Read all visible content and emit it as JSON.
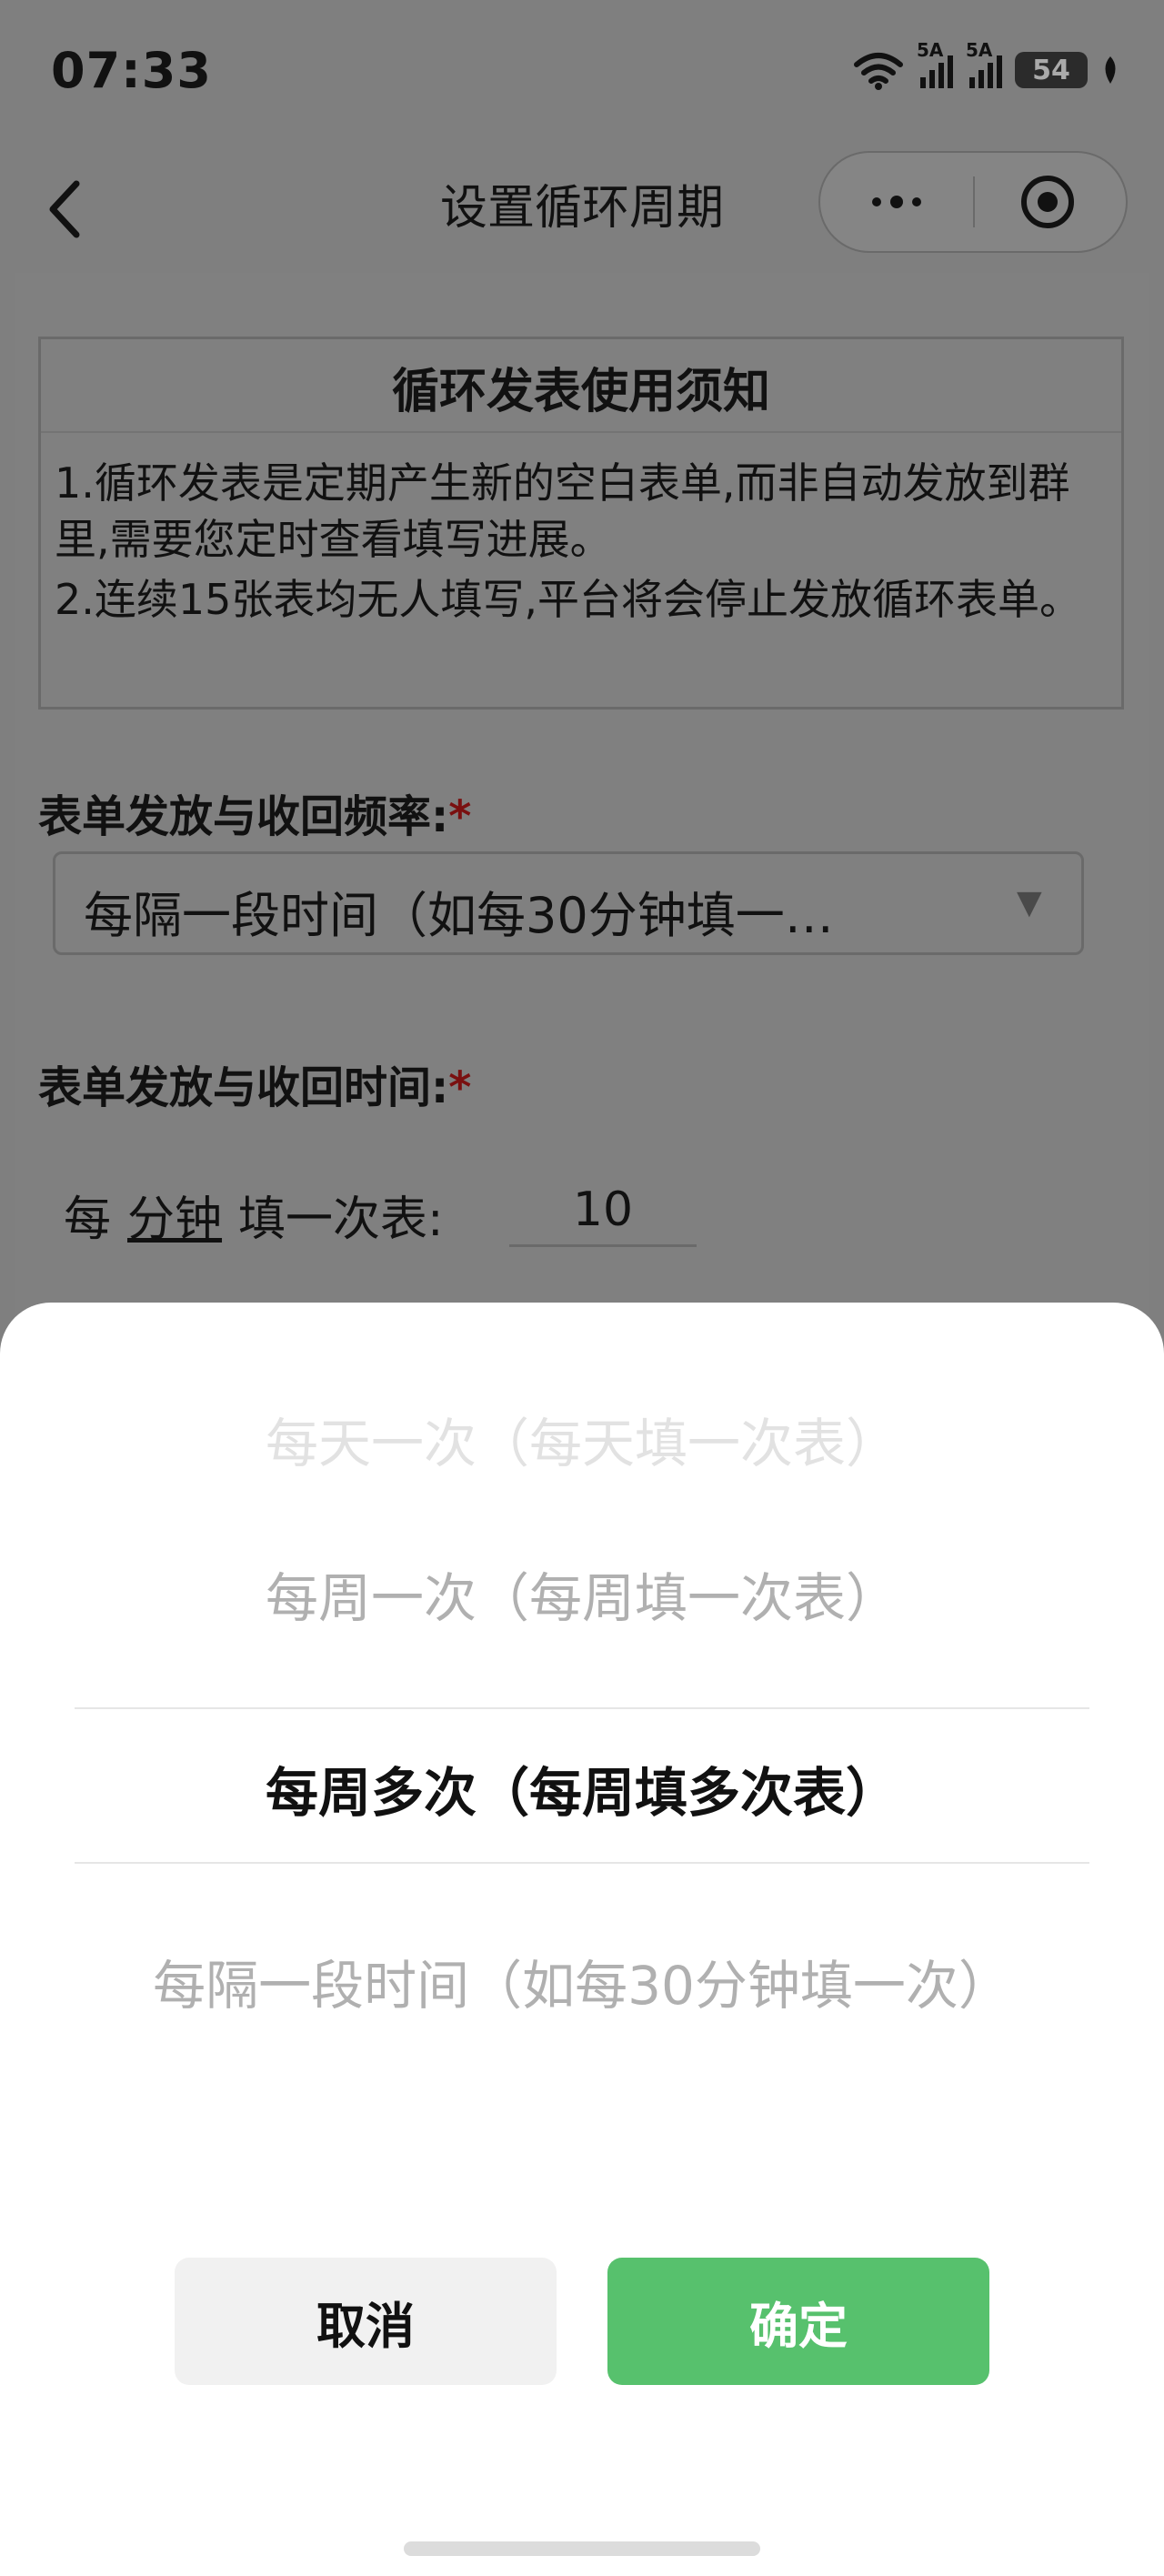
{
  "status_bar": {
    "time": "07:33",
    "signal1_label": "5A",
    "signal2_label": "5A",
    "battery": "54"
  },
  "nav": {
    "title": "设置循环周期"
  },
  "notice": {
    "title": "循环发表使用须知",
    "items": [
      "1.循环发表是定期产生新的空白表单,而非自动发放到群里,需要您定时查看填写进展。",
      "2.连续15张表均无人填写,平台将会停止发放循环表单。"
    ]
  },
  "form": {
    "frequency_label": "表单发放与收回频率:",
    "frequency_required": "*",
    "frequency_value": "每隔一段时间（如每30分钟填一…",
    "frequency_arrow": "▼",
    "time_label": "表单发放与收回时间:",
    "time_required": "*",
    "per_prefix": "每",
    "per_unit": "分钟",
    "per_suffix": "填一次表:",
    "interval_value": "10"
  },
  "picker": {
    "options": [
      "每天一次（每天填一次表）",
      "每周一次（每周填一次表）",
      "每周多次（每周填多次表）",
      "每隔一段时间（如每30分钟填一次）"
    ],
    "cancel_label": "取消",
    "confirm_label": "确定"
  },
  "colors": {
    "confirm": "#57c16d",
    "required": "#7a1010",
    "overlay": "#7f7f7f"
  }
}
